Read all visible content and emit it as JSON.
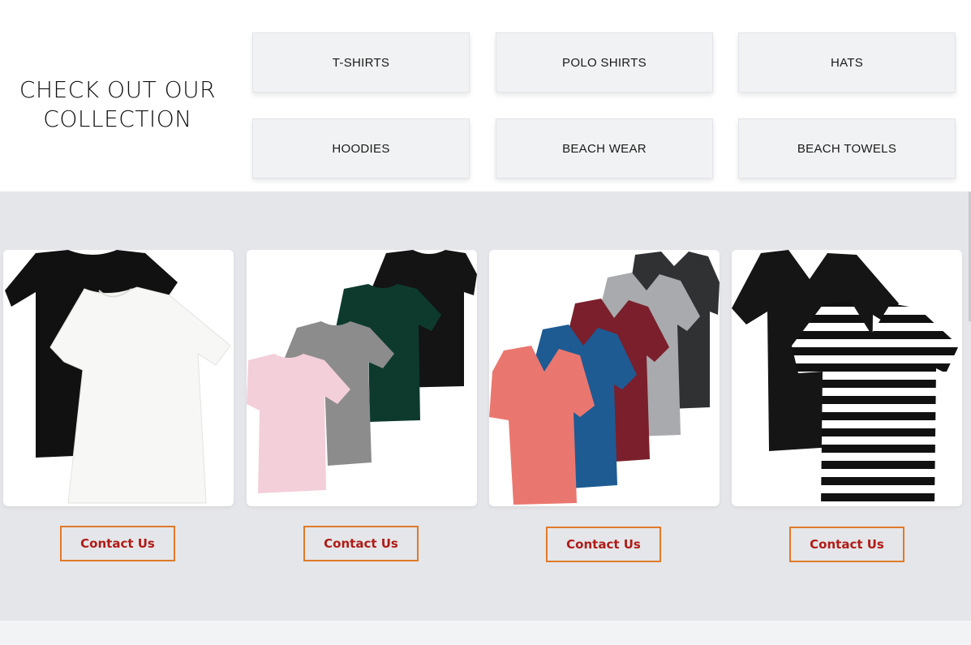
{
  "section": {
    "heading_line1": "CHECK OUT OUR",
    "heading_line2": "COLLECTION"
  },
  "categories": [
    {
      "label": "T-SHIRTS"
    },
    {
      "label": "POLO SHIRTS"
    },
    {
      "label": "HATS"
    },
    {
      "label": "HOODIES"
    },
    {
      "label": "BEACH WEAR"
    },
    {
      "label": "BEACH TOWELS"
    }
  ],
  "products": [
    {
      "image": "black-and-white-tshirts",
      "button_label": "Contact Us"
    },
    {
      "image": "four-crewneck-tshirts",
      "button_label": "Contact Us"
    },
    {
      "image": "five-vneck-tshirts",
      "button_label": "Contact Us"
    },
    {
      "image": "black-and-striped-tshirts",
      "button_label": "Contact Us"
    }
  ],
  "colors": {
    "accent_border": "#e07a2a",
    "button_text": "#b01c17",
    "section_bg": "#e5e6e9"
  }
}
